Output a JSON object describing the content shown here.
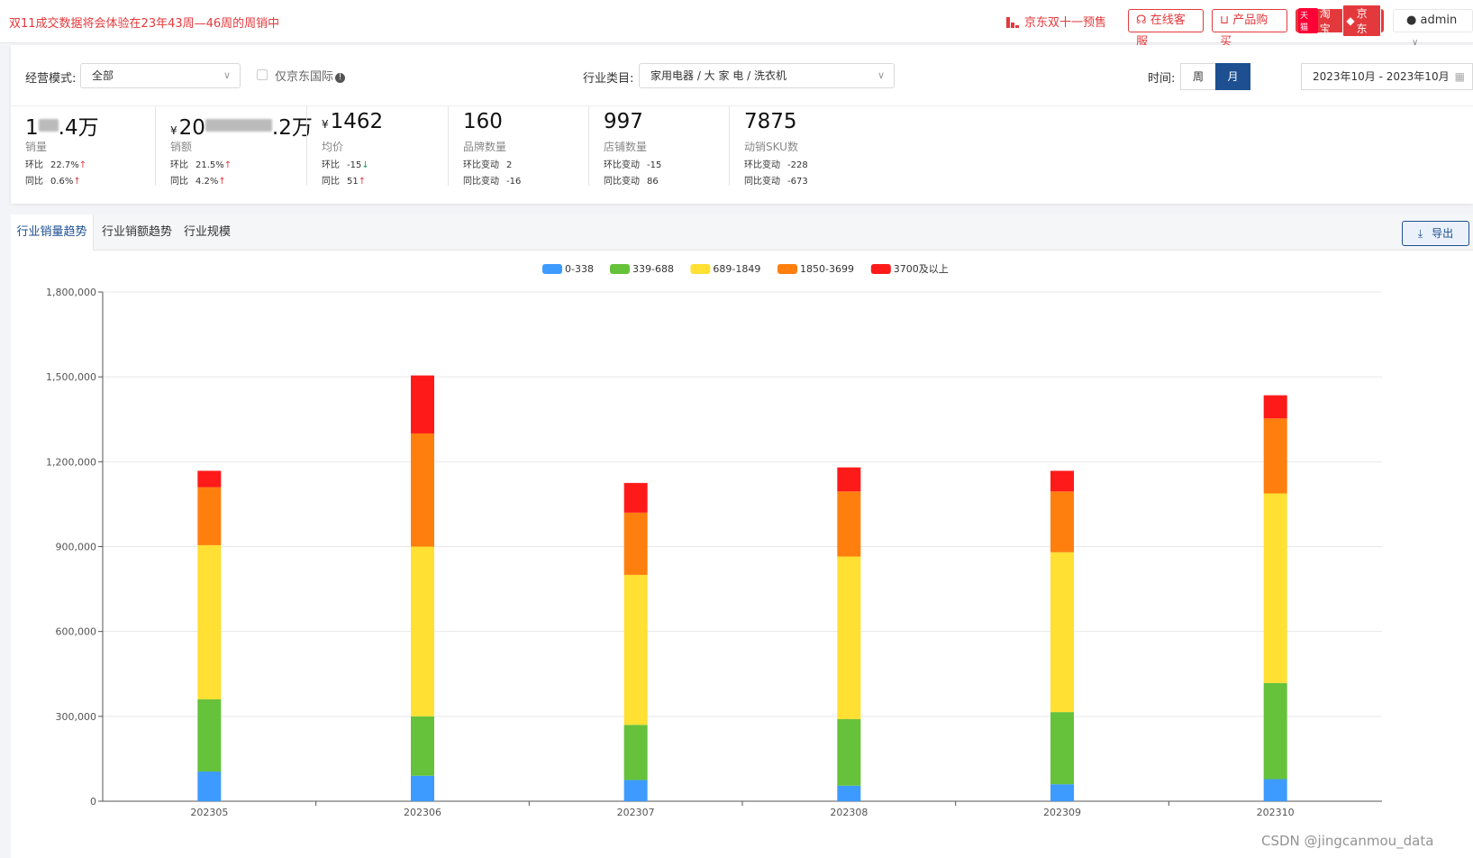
{
  "topbar": {
    "notice": "双11成交数据将会体验在23年43周—46周的周销中",
    "jd_presale": "京东双十一预售",
    "online_service": "在线客服",
    "product_purchase": "产品购买",
    "taobao": "淘宝",
    "tmall_badge": "天猫",
    "jd": "京东",
    "admin": "admin"
  },
  "filters": {
    "mode_label": "经营模式:",
    "mode_value": "全部",
    "jd_intl_label": "仅京东国际",
    "category_label": "行业类目:",
    "category_value": "家用电器 / 大 家 电 / 洗衣机",
    "time_label": "时间:",
    "week": "周",
    "month": "月",
    "date_range": "2023年10月 - 2023年10月"
  },
  "metrics": [
    {
      "value_pre": "1",
      "value_post": ".4万",
      "currency": "",
      "name": "销量",
      "r1_label": "环比",
      "r1_value": "22.7%",
      "r1_dir": "up",
      "r2_label": "同比",
      "r2_value": "0.6%",
      "r2_dir": "up"
    },
    {
      "value_pre": "20",
      "value_post": ".2万",
      "currency": "¥",
      "name": "销额",
      "r1_label": "环比",
      "r1_value": "21.5%",
      "r1_dir": "up",
      "r2_label": "同比",
      "r2_value": "4.2%",
      "r2_dir": "up"
    },
    {
      "value_pre": "1462",
      "value_post": "",
      "currency": "¥",
      "name": "均价",
      "r1_label": "环比",
      "r1_value": "-15",
      "r1_dir": "down",
      "r2_label": "同比",
      "r2_value": "51",
      "r2_dir": "up"
    },
    {
      "value_pre": "160",
      "value_post": "",
      "currency": "",
      "name": "品牌数量",
      "r1_label": "环比变动",
      "r1_value": "2",
      "r1_dir": "",
      "r2_label": "同比变动",
      "r2_value": "-16",
      "r2_dir": ""
    },
    {
      "value_pre": "997",
      "value_post": "",
      "currency": "",
      "name": "店铺数量",
      "r1_label": "环比变动",
      "r1_value": "-15",
      "r1_dir": "",
      "r2_label": "同比变动",
      "r2_value": "86",
      "r2_dir": ""
    },
    {
      "value_pre": "7875",
      "value_post": "",
      "currency": "",
      "name": "动销SKU数",
      "r1_label": "环比变动",
      "r1_value": "-228",
      "r1_dir": "",
      "r2_label": "同比变动",
      "r2_value": "-673",
      "r2_dir": ""
    }
  ],
  "tabs": [
    "行业销量趋势",
    "行业销额趋势",
    "行业规模"
  ],
  "export_label": "导出",
  "watermark": "CSDN @jingcanmou_data",
  "chart_data": {
    "type": "bar",
    "stacked": true,
    "categories": [
      "202305",
      "202306",
      "202307",
      "202308",
      "202309",
      "202310"
    ],
    "ylim": [
      0,
      1800000
    ],
    "yticks": [
      0,
      300000,
      600000,
      900000,
      1200000,
      1500000,
      1800000
    ],
    "ytick_labels": [
      "0",
      "300,000",
      "600,000",
      "900,000",
      "1,200,000",
      "1,500,000",
      "1,800,000"
    ],
    "legend_position": "top-center",
    "grid": true,
    "series": [
      {
        "name": "0-338",
        "color": "#3d9bff",
        "values": [
          105000,
          90000,
          75000,
          55000,
          60000,
          78000
        ]
      },
      {
        "name": "339-688",
        "color": "#66c23a",
        "values": [
          255000,
          210000,
          195000,
          235000,
          255000,
          340000
        ]
      },
      {
        "name": "689-1849",
        "color": "#ffe033",
        "values": [
          545000,
          600000,
          530000,
          575000,
          565000,
          670000
        ]
      },
      {
        "name": "1850-3699",
        "color": "#ff7f0e",
        "values": [
          205000,
          400000,
          220000,
          230000,
          215000,
          265000
        ]
      },
      {
        "name": "3700及以上",
        "color": "#ff1a1a",
        "values": [
          58000,
          205000,
          105000,
          85000,
          73000,
          82000
        ]
      }
    ]
  }
}
